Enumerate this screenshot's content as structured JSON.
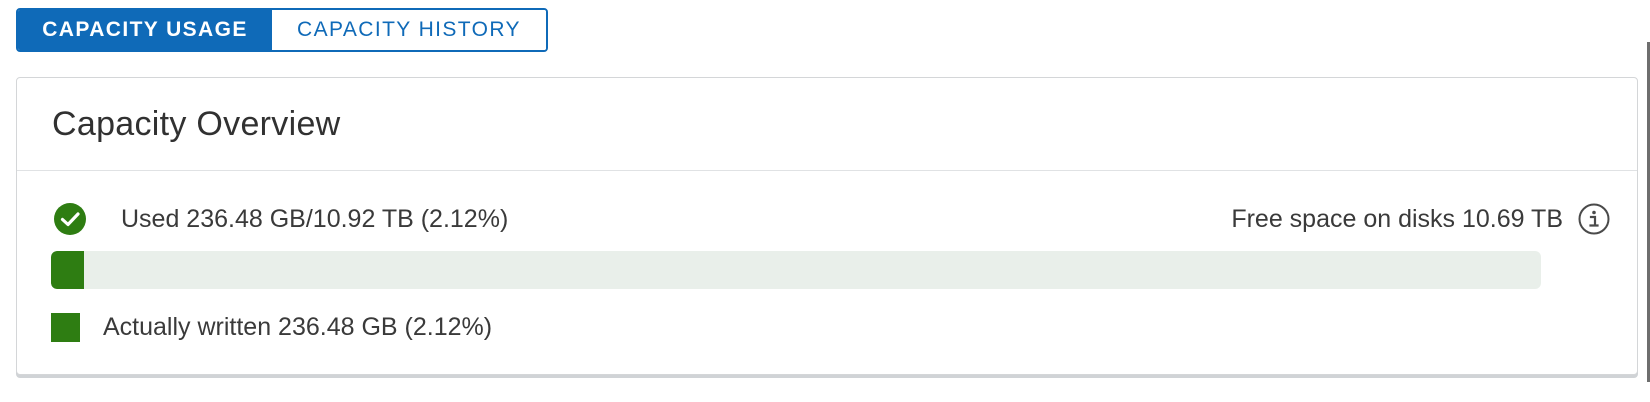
{
  "tabs": [
    {
      "label": "CAPACITY USAGE",
      "active": true
    },
    {
      "label": "CAPACITY HISTORY",
      "active": false
    }
  ],
  "card": {
    "title": "Capacity Overview",
    "status_icon": "check-circle-icon",
    "used_text": "Used 236.48 GB/10.92 TB (2.12%)",
    "free_text": "Free space on disks 10.69 TB",
    "info_icon": "info-icon",
    "bar": {
      "used_percent": 2.12
    },
    "legend": {
      "label": "Actually written 236.48 GB (2.12%)"
    }
  },
  "colors": {
    "brand_blue": "#0f6ab8",
    "used_green": "#2e7d12",
    "track": "#e9efea"
  }
}
